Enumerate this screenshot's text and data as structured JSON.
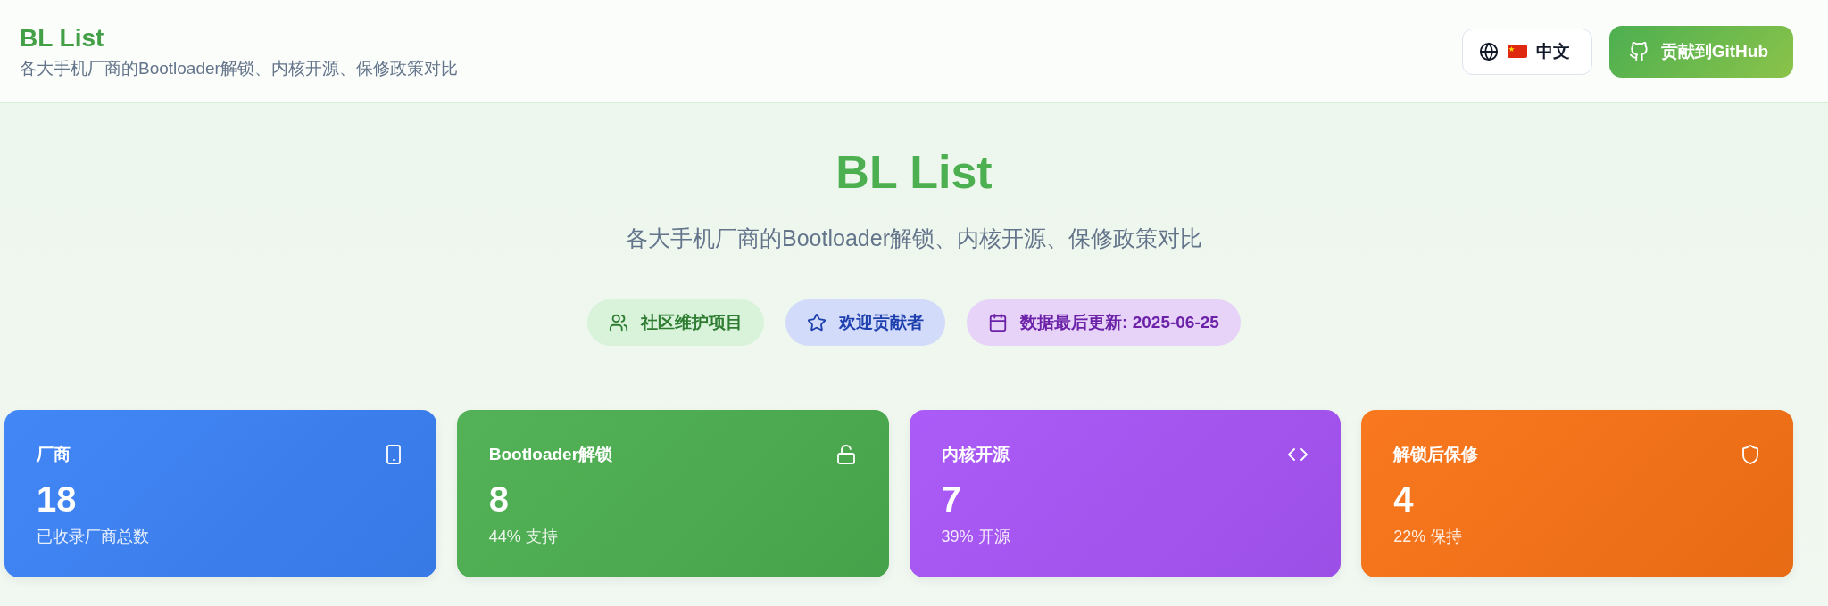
{
  "header": {
    "title": "BL List",
    "subtitle": "各大手机厂商的Bootloader解锁、内核开源、保修政策对比",
    "language_button": {
      "label": "中文"
    },
    "github_button": {
      "label": "贡献到GitHub"
    }
  },
  "hero": {
    "title": "BL List",
    "subtitle": "各大手机厂商的Bootloader解锁、内核开源、保修政策对比",
    "badges": [
      {
        "label": "社区维护项目",
        "color": "#2e7d32"
      },
      {
        "label": "欢迎贡献者",
        "color": "#1e40af"
      },
      {
        "label": "数据最后更新: 2025-06-25",
        "color": "#6b21a8"
      }
    ]
  },
  "stats": [
    {
      "label": "厂商",
      "value": "18",
      "note": "已收录厂商总数",
      "color": "#3b82f6"
    },
    {
      "label": "Bootloader解锁",
      "value": "8",
      "note": "44% 支持",
      "color": "#4caf50"
    },
    {
      "label": "内核开源",
      "value": "7",
      "note": "39% 开源",
      "color": "#a855f7"
    },
    {
      "label": "解锁后保修",
      "value": "4",
      "note": "22% 保持",
      "color": "#f97316"
    }
  ]
}
